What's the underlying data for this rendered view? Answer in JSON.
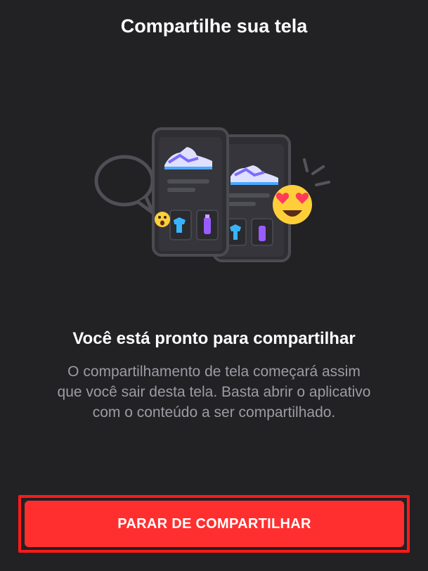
{
  "header": {
    "title": "Compartilhe sua tela"
  },
  "main": {
    "heading": "Você está pronto para compartilhar",
    "description": "O compartilhamento de tela começará assim que você sair desta tela. Basta abrir o aplicativo com o conteúdo a ser compartilhado."
  },
  "footer": {
    "stop_label": "PARAR DE COMPARTILHAR"
  },
  "illustration": {
    "icons": [
      "speech-bubble-icon",
      "phone-icon",
      "sneaker-icon",
      "tshirt-icon",
      "bottle-icon",
      "surprised-emoji-icon",
      "heart-eyes-emoji-icon",
      "sparkle-lines-icon"
    ]
  },
  "colors": {
    "background": "#222124",
    "button": "#ff2f2f",
    "highlight_border": "#ff1a1a",
    "text_primary": "#ffffff",
    "text_secondary": "#9c9ca2",
    "outline": "#4f4f56"
  }
}
